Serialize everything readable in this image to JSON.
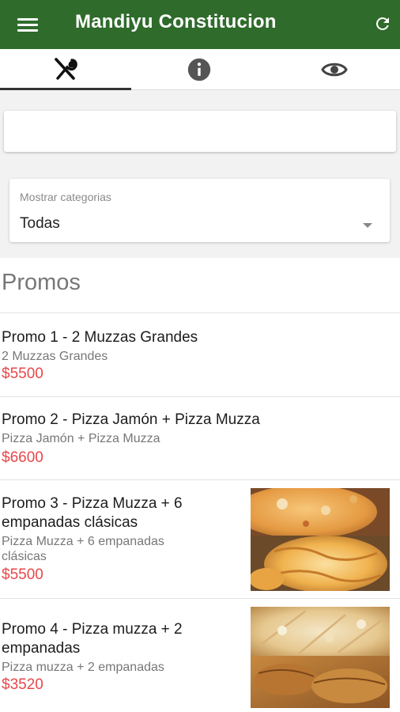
{
  "app": {
    "title": "Mandiyu Constitucion",
    "theme_color": "#2f6b2b",
    "price_color": "#e8474a"
  },
  "tabs": [
    {
      "icon": "fork-knife-icon",
      "active": true
    },
    {
      "icon": "info-icon",
      "active": false
    },
    {
      "icon": "eye-icon",
      "active": false
    }
  ],
  "search": {
    "value": "",
    "placeholder": ""
  },
  "category_filter": {
    "label": "Mostrar categorias",
    "value": "Todas"
  },
  "section": {
    "title": "Promos",
    "items": [
      {
        "name": "Promo 1 - 2 Muzzas Grandes",
        "description": "2 Muzzas Grandes",
        "price": "$5500"
      },
      {
        "name": "Promo 2 - Pizza Jamón + Pizza Muzza",
        "description": "Pizza Jamón + Pizza Muzza",
        "price": "$6600"
      },
      {
        "name_line1": "Promo 3 - Pizza Muzza + 6",
        "name_line2": "empanadas clásicas",
        "desc_line1": "Pizza Muzza + 6 empanadas",
        "desc_line2": "clásicas",
        "price": "$5500",
        "image": "pizza-and-empanadas-photo"
      },
      {
        "name_line1": "Promo 4 - Pizza muzza + 2",
        "name_line2": "empanadas",
        "description": "Pizza muzza + 2 empanadas",
        "price": "$3520",
        "image": "pizza-and-empanadas-photo"
      }
    ]
  }
}
